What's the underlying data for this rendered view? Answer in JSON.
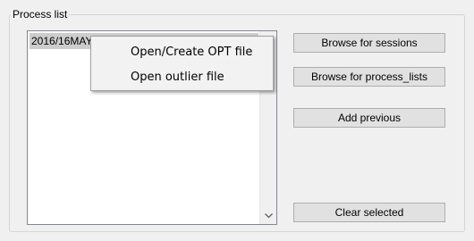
{
  "group": {
    "title": "Process list"
  },
  "listbox": {
    "items": [
      "2016/16MAY20MA_1103-1"
    ]
  },
  "buttons": {
    "browse_sessions": "Browse for sessions",
    "browse_process_lists": "Browse for process_lists",
    "add_previous": "Add previous",
    "clear_selected": "Clear selected"
  },
  "context_menu": {
    "items": [
      "Open/Create OPT file",
      "Open outlier file"
    ]
  },
  "icons": {
    "scroll_down": "chevron-down-icon"
  }
}
